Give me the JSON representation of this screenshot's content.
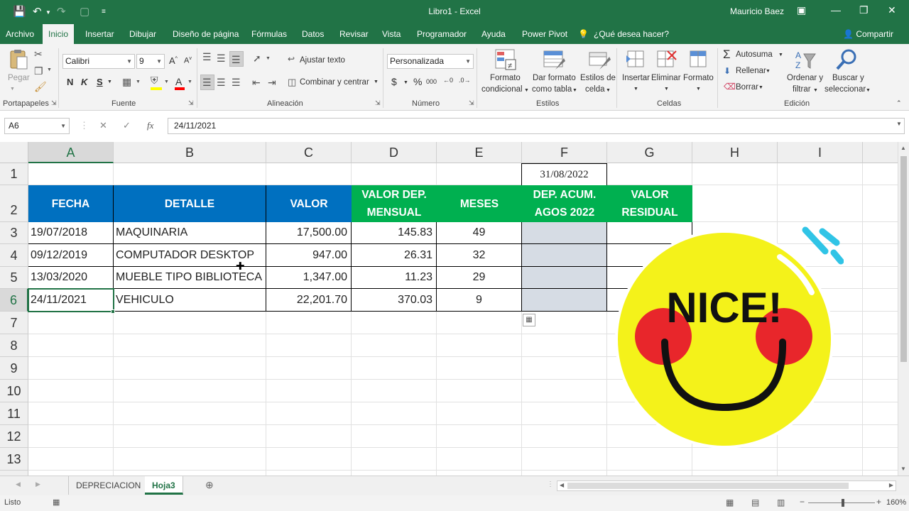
{
  "window": {
    "title": "Libro1 - Excel",
    "user": "Mauricio Baez"
  },
  "tabs": [
    "Archivo",
    "Inicio",
    "Insertar",
    "Dibujar",
    "Diseño de página",
    "Fórmulas",
    "Datos",
    "Revisar",
    "Vista",
    "Programador",
    "Ayuda",
    "Power Pivot",
    "¿Qué desea hacer?"
  ],
  "share_label": "Compartir",
  "ribbon": {
    "paste": "Pegar",
    "font_name": "Calibri",
    "font_size": "9",
    "wrap_text": "Ajustar texto",
    "merge_center": "Combinar y centrar",
    "number_format": "Personalizada",
    "cond_format": [
      "Formato",
      "condicional"
    ],
    "table_format": [
      "Dar formato",
      "como tabla"
    ],
    "cell_styles": [
      "Estilos de",
      "celda"
    ],
    "insert": "Insertar",
    "delete": "Eliminar",
    "format": "Formato",
    "autosum": "Autosuma",
    "fill": "Rellenar",
    "clear": "Borrar",
    "sort": [
      "Ordenar y",
      "filtrar"
    ],
    "find": [
      "Buscar y",
      "seleccionar"
    ],
    "groups": {
      "clipboard": "Portapapeles",
      "font": "Fuente",
      "alignment": "Alineación",
      "number": "Número",
      "styles": "Estilos",
      "cells": "Celdas",
      "editing": "Edición"
    },
    "bold": "N",
    "italic": "K",
    "underline": "S"
  },
  "formula_bar": {
    "name_box": "A6",
    "formula": "24/11/2021"
  },
  "columns": [
    "A",
    "B",
    "C",
    "D",
    "E",
    "F",
    "G",
    "H",
    "I"
  ],
  "rows": [
    "1",
    "2",
    "3",
    "4",
    "5",
    "6",
    "7",
    "8",
    "9",
    "10",
    "11",
    "12",
    "13"
  ],
  "sheet": {
    "f1_date": "31/08/2022",
    "headers": {
      "fecha": "FECHA",
      "detalle": "DETALLE",
      "valor": "VALOR",
      "valor_dep_mensual": "VALOR DEP. MENSUAL",
      "meses": "MESES",
      "dep_acum": "DEP. ACUM. AGOS 2022",
      "valor_residual": "VALOR RESIDUAL"
    },
    "data": [
      {
        "fecha": "19/07/2018",
        "detalle": "MAQUINARIA",
        "valor": "17,500.00",
        "dep": "145.83",
        "meses": "49"
      },
      {
        "fecha": "09/12/2019",
        "detalle": "COMPUTADOR DESKTOP",
        "valor": "947.00",
        "dep": "26.31",
        "meses": "32"
      },
      {
        "fecha": "13/03/2020",
        "detalle": "MUEBLE TIPO BIBLIOTECA",
        "valor": "1,347.00",
        "dep": "11.23",
        "meses": "29"
      },
      {
        "fecha": "24/11/2021",
        "detalle": "VEHICULO",
        "valor": "22,201.70",
        "dep": "370.03",
        "meses": "9"
      }
    ]
  },
  "sheet_tabs": [
    "DEPRECIACION",
    "Hoja3"
  ],
  "status": {
    "ready": "Listo",
    "zoom": "160%"
  },
  "sticker_text": "NICE!",
  "colors": {
    "excel_green": "#217346",
    "header_blue": "#0070c0",
    "header_green": "#00b050",
    "shade": "#d6dce4"
  }
}
